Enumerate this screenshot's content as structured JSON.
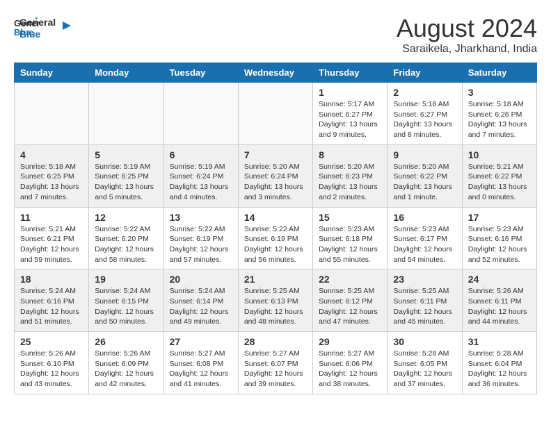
{
  "logo": {
    "line1": "General",
    "line2": "Blue"
  },
  "title": "August 2024",
  "subtitle": "Saraikela, Jharkhand, India",
  "days": [
    "Sunday",
    "Monday",
    "Tuesday",
    "Wednesday",
    "Thursday",
    "Friday",
    "Saturday"
  ],
  "weeks": [
    [
      {
        "date": "",
        "text": ""
      },
      {
        "date": "",
        "text": ""
      },
      {
        "date": "",
        "text": ""
      },
      {
        "date": "",
        "text": ""
      },
      {
        "date": "1",
        "text": "Sunrise: 5:17 AM\nSunset: 6:27 PM\nDaylight: 13 hours\nand 9 minutes."
      },
      {
        "date": "2",
        "text": "Sunrise: 5:18 AM\nSunset: 6:27 PM\nDaylight: 13 hours\nand 8 minutes."
      },
      {
        "date": "3",
        "text": "Sunrise: 5:18 AM\nSunset: 6:26 PM\nDaylight: 13 hours\nand 7 minutes."
      }
    ],
    [
      {
        "date": "4",
        "text": "Sunrise: 5:18 AM\nSunset: 6:25 PM\nDaylight: 13 hours\nand 7 minutes."
      },
      {
        "date": "5",
        "text": "Sunrise: 5:19 AM\nSunset: 6:25 PM\nDaylight: 13 hours\nand 5 minutes."
      },
      {
        "date": "6",
        "text": "Sunrise: 5:19 AM\nSunset: 6:24 PM\nDaylight: 13 hours\nand 4 minutes."
      },
      {
        "date": "7",
        "text": "Sunrise: 5:20 AM\nSunset: 6:24 PM\nDaylight: 13 hours\nand 3 minutes."
      },
      {
        "date": "8",
        "text": "Sunrise: 5:20 AM\nSunset: 6:23 PM\nDaylight: 13 hours\nand 2 minutes."
      },
      {
        "date": "9",
        "text": "Sunrise: 5:20 AM\nSunset: 6:22 PM\nDaylight: 13 hours\nand 1 minute."
      },
      {
        "date": "10",
        "text": "Sunrise: 5:21 AM\nSunset: 6:22 PM\nDaylight: 13 hours\nand 0 minutes."
      }
    ],
    [
      {
        "date": "11",
        "text": "Sunrise: 5:21 AM\nSunset: 6:21 PM\nDaylight: 12 hours\nand 59 minutes."
      },
      {
        "date": "12",
        "text": "Sunrise: 5:22 AM\nSunset: 6:20 PM\nDaylight: 12 hours\nand 58 minutes."
      },
      {
        "date": "13",
        "text": "Sunrise: 5:22 AM\nSunset: 6:19 PM\nDaylight: 12 hours\nand 57 minutes."
      },
      {
        "date": "14",
        "text": "Sunrise: 5:22 AM\nSunset: 6:19 PM\nDaylight: 12 hours\nand 56 minutes."
      },
      {
        "date": "15",
        "text": "Sunrise: 5:23 AM\nSunset: 6:18 PM\nDaylight: 12 hours\nand 55 minutes."
      },
      {
        "date": "16",
        "text": "Sunrise: 5:23 AM\nSunset: 6:17 PM\nDaylight: 12 hours\nand 54 minutes."
      },
      {
        "date": "17",
        "text": "Sunrise: 5:23 AM\nSunset: 6:16 PM\nDaylight: 12 hours\nand 52 minutes."
      }
    ],
    [
      {
        "date": "18",
        "text": "Sunrise: 5:24 AM\nSunset: 6:16 PM\nDaylight: 12 hours\nand 51 minutes."
      },
      {
        "date": "19",
        "text": "Sunrise: 5:24 AM\nSunset: 6:15 PM\nDaylight: 12 hours\nand 50 minutes."
      },
      {
        "date": "20",
        "text": "Sunrise: 5:24 AM\nSunset: 6:14 PM\nDaylight: 12 hours\nand 49 minutes."
      },
      {
        "date": "21",
        "text": "Sunrise: 5:25 AM\nSunset: 6:13 PM\nDaylight: 12 hours\nand 48 minutes."
      },
      {
        "date": "22",
        "text": "Sunrise: 5:25 AM\nSunset: 6:12 PM\nDaylight: 12 hours\nand 47 minutes."
      },
      {
        "date": "23",
        "text": "Sunrise: 5:25 AM\nSunset: 6:11 PM\nDaylight: 12 hours\nand 45 minutes."
      },
      {
        "date": "24",
        "text": "Sunrise: 5:26 AM\nSunset: 6:11 PM\nDaylight: 12 hours\nand 44 minutes."
      }
    ],
    [
      {
        "date": "25",
        "text": "Sunrise: 5:26 AM\nSunset: 6:10 PM\nDaylight: 12 hours\nand 43 minutes."
      },
      {
        "date": "26",
        "text": "Sunrise: 5:26 AM\nSunset: 6:09 PM\nDaylight: 12 hours\nand 42 minutes."
      },
      {
        "date": "27",
        "text": "Sunrise: 5:27 AM\nSunset: 6:08 PM\nDaylight: 12 hours\nand 41 minutes."
      },
      {
        "date": "28",
        "text": "Sunrise: 5:27 AM\nSunset: 6:07 PM\nDaylight: 12 hours\nand 39 minutes."
      },
      {
        "date": "29",
        "text": "Sunrise: 5:27 AM\nSunset: 6:06 PM\nDaylight: 12 hours\nand 38 minutes."
      },
      {
        "date": "30",
        "text": "Sunrise: 5:28 AM\nSunset: 6:05 PM\nDaylight: 12 hours\nand 37 minutes."
      },
      {
        "date": "31",
        "text": "Sunrise: 5:28 AM\nSunset: 6:04 PM\nDaylight: 12 hours\nand 36 minutes."
      }
    ]
  ]
}
